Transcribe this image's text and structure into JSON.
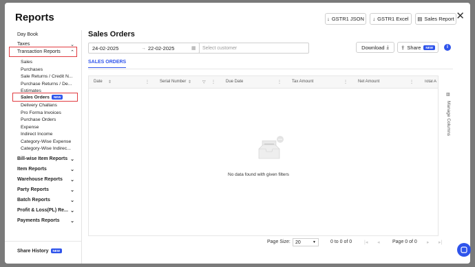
{
  "modal": {
    "title": "Reports",
    "close_icon": "close-icon"
  },
  "header_buttons": {
    "gstr1_json": "GSTR1 JSON",
    "gstr1_excel": "GSTR1 Excel",
    "sales_report": "Sales Report"
  },
  "sidebar": {
    "day_book": "Day Book",
    "taxes": "Taxes",
    "transaction_reports": "Transaction Reports",
    "sub_items": [
      "Sales",
      "Purchases",
      "Sale Returns / Credit N...",
      "Purchase Returns / De...",
      "Estimates",
      "Sales Orders",
      "Delivery Challans",
      "Pro Forma Invoices",
      "Purchase Orders",
      "Expense",
      "Indirect Income",
      "Category-Wise Expense",
      "Category-Wise Indirec..."
    ],
    "groups": [
      "Bill-wise Item Reports",
      "Item Reports",
      "Warehouse Reports",
      "Party Reports",
      "Batch Reports",
      "Profit & Loss(PL) Re...",
      "Payments Reports"
    ],
    "share_history": "Share History",
    "new_badge": "NEW"
  },
  "main": {
    "title": "Sales Orders",
    "start_date": "24-02-2025",
    "end_date": "22-02-2025",
    "customer_placeholder": "Select customer",
    "download": "Download",
    "share": "Share",
    "share_badge": "NEW",
    "tab": "SALES ORDERS"
  },
  "table": {
    "columns": [
      "Date",
      "Serial Number",
      "Due Date",
      "Tax Amount",
      "Net Amount",
      "Total Amo"
    ],
    "empty_message": "No data found with given filters",
    "manage_columns": "Manage Columns"
  },
  "pagination": {
    "page_size_label": "Page Size:",
    "page_size": "20",
    "range": "0 to 0 of 0",
    "page": "Page 0 of 0"
  },
  "colors": {
    "accent": "#2f54eb",
    "highlight": "#e0393e"
  }
}
